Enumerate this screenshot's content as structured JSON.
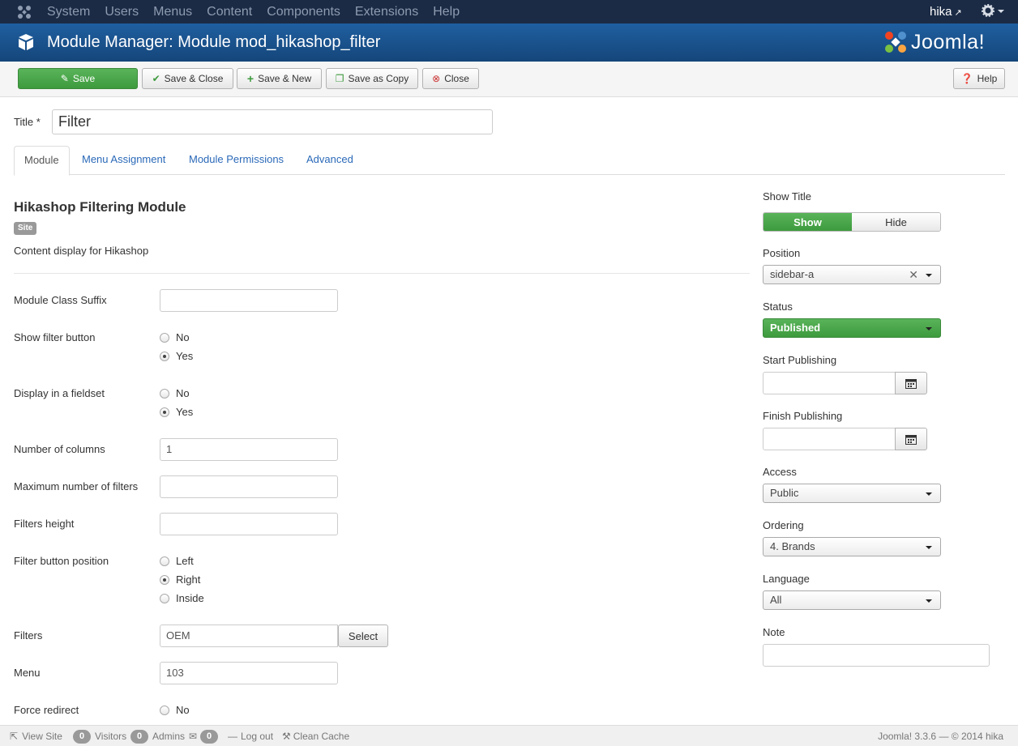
{
  "topnav": {
    "menu": [
      "System",
      "Users",
      "Menus",
      "Content",
      "Components",
      "Extensions",
      "Help"
    ],
    "user": "hika"
  },
  "header": {
    "title": "Module Manager: Module mod_hikashop_filter",
    "brand": "Joomla!"
  },
  "toolbar": {
    "save": "Save",
    "save_close": "Save & Close",
    "save_new": "Save & New",
    "save_copy": "Save as Copy",
    "close": "Close",
    "help": "Help"
  },
  "title_field": {
    "label": "Title",
    "required": "*",
    "value": "Filter"
  },
  "tabs": [
    "Module",
    "Menu Assignment",
    "Module Permissions",
    "Advanced"
  ],
  "module": {
    "name": "Hikashop Filtering Module",
    "badge": "Site",
    "description": "Content display for Hikashop"
  },
  "fields": {
    "class_suffix": {
      "label": "Module Class Suffix",
      "value": ""
    },
    "show_filter_button": {
      "label": "Show filter button",
      "options": [
        "No",
        "Yes"
      ],
      "selected": "Yes"
    },
    "display_fieldset": {
      "label": "Display in a fieldset",
      "options": [
        "No",
        "Yes"
      ],
      "selected": "Yes"
    },
    "num_columns": {
      "label": "Number of columns",
      "value": "1"
    },
    "max_filters": {
      "label": "Maximum number of filters",
      "value": ""
    },
    "filters_height": {
      "label": "Filters height",
      "value": ""
    },
    "button_position": {
      "label": "Filter button position",
      "options": [
        "Left",
        "Right",
        "Inside"
      ],
      "selected": "Right"
    },
    "filters": {
      "label": "Filters",
      "value": "OEM",
      "button": "Select"
    },
    "menu": {
      "label": "Menu",
      "value": "103"
    },
    "force_redirect": {
      "label": "Force redirect",
      "options": [
        "No"
      ]
    }
  },
  "sidebar": {
    "show_title": {
      "label": "Show Title",
      "show": "Show",
      "hide": "Hide"
    },
    "position": {
      "label": "Position",
      "value": "sidebar-a"
    },
    "status": {
      "label": "Status",
      "value": "Published"
    },
    "start_publishing": {
      "label": "Start Publishing"
    },
    "finish_publishing": {
      "label": "Finish Publishing"
    },
    "access": {
      "label": "Access",
      "value": "Public"
    },
    "ordering": {
      "label": "Ordering",
      "value": "4. Brands"
    },
    "language": {
      "label": "Language",
      "value": "All"
    },
    "note": {
      "label": "Note"
    }
  },
  "statusbar": {
    "view_site": "View Site",
    "visitors_count": "0",
    "visitors": "Visitors",
    "admins_count": "0",
    "admins": "Admins",
    "messages_count": "0",
    "logout": "Log out",
    "clean_cache": "Clean Cache",
    "version": "Joomla! 3.3.6  —  © 2014 hika"
  },
  "colors": {
    "nav": "#1b2b45",
    "header": "#1a5592",
    "green": "#46a546",
    "link": "#2a69b8"
  }
}
